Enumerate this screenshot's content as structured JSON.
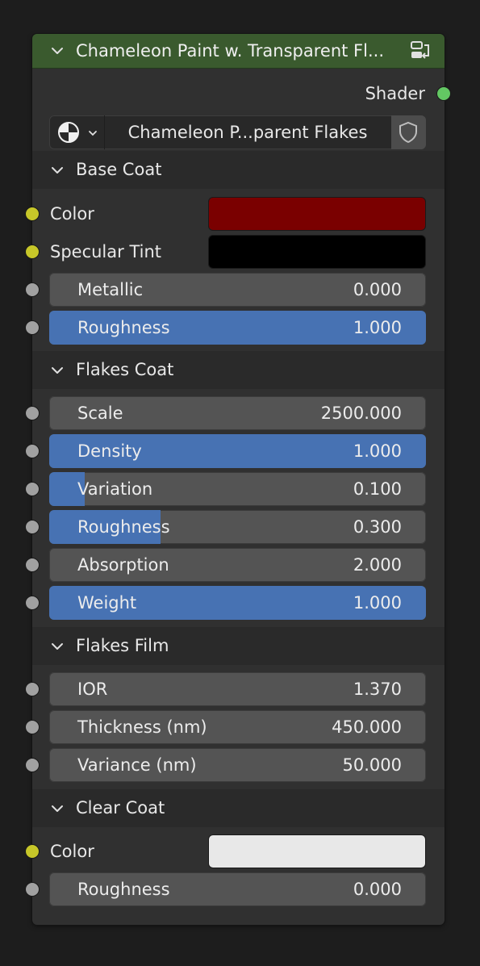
{
  "node": {
    "title": "Chameleon Paint w. Transparent Fl...",
    "header_color": "#3a5a2e",
    "output": {
      "label": "Shader",
      "socket_color": "#63c763"
    },
    "datablock": {
      "name": "Chameleon P...parent Flakes",
      "type_icon": "node-tree-icon",
      "fake_user_icon": "shield-icon"
    }
  },
  "panels": {
    "base_coat": {
      "title": "Base Coat",
      "color": {
        "label": "Color",
        "value": "#7a0000"
      },
      "specular_tint": {
        "label": "Specular Tint",
        "value": "#000000"
      },
      "metallic": {
        "label": "Metallic",
        "value": "0.000",
        "fill": 0.0
      },
      "roughness": {
        "label": "Roughness",
        "value": "1.000",
        "fill": 1.0
      }
    },
    "flakes_coat": {
      "title": "Flakes Coat",
      "scale": {
        "label": "Scale",
        "value": "2500.000",
        "fill": 0.0
      },
      "density": {
        "label": "Density",
        "value": "1.000",
        "fill": 1.0
      },
      "variation": {
        "label": "Variation",
        "value": "0.100",
        "fill": 0.1
      },
      "roughness": {
        "label": "Roughness",
        "value": "0.300",
        "fill": 0.3
      },
      "absorption": {
        "label": "Absorption",
        "value": "2.000",
        "fill": 0.0
      },
      "weight": {
        "label": "Weight",
        "value": "1.000",
        "fill": 1.0
      }
    },
    "flakes_film": {
      "title": "Flakes Film",
      "ior": {
        "label": "IOR",
        "value": "1.370",
        "fill": 0.0
      },
      "thickness": {
        "label": "Thickness (nm)",
        "value": "450.000",
        "fill": 0.0
      },
      "variance": {
        "label": "Variance (nm)",
        "value": "50.000",
        "fill": 0.0
      }
    },
    "clear_coat": {
      "title": "Clear Coat",
      "color": {
        "label": "Color",
        "value": "#e8e8e8"
      },
      "roughness": {
        "label": "Roughness",
        "value": "0.000",
        "fill": 0.0
      }
    }
  },
  "colors": {
    "slider_fill": "#4772b3",
    "slider_bg": "#545454",
    "color_socket": "#c7c729",
    "float_socket": "#a1a1a1"
  }
}
